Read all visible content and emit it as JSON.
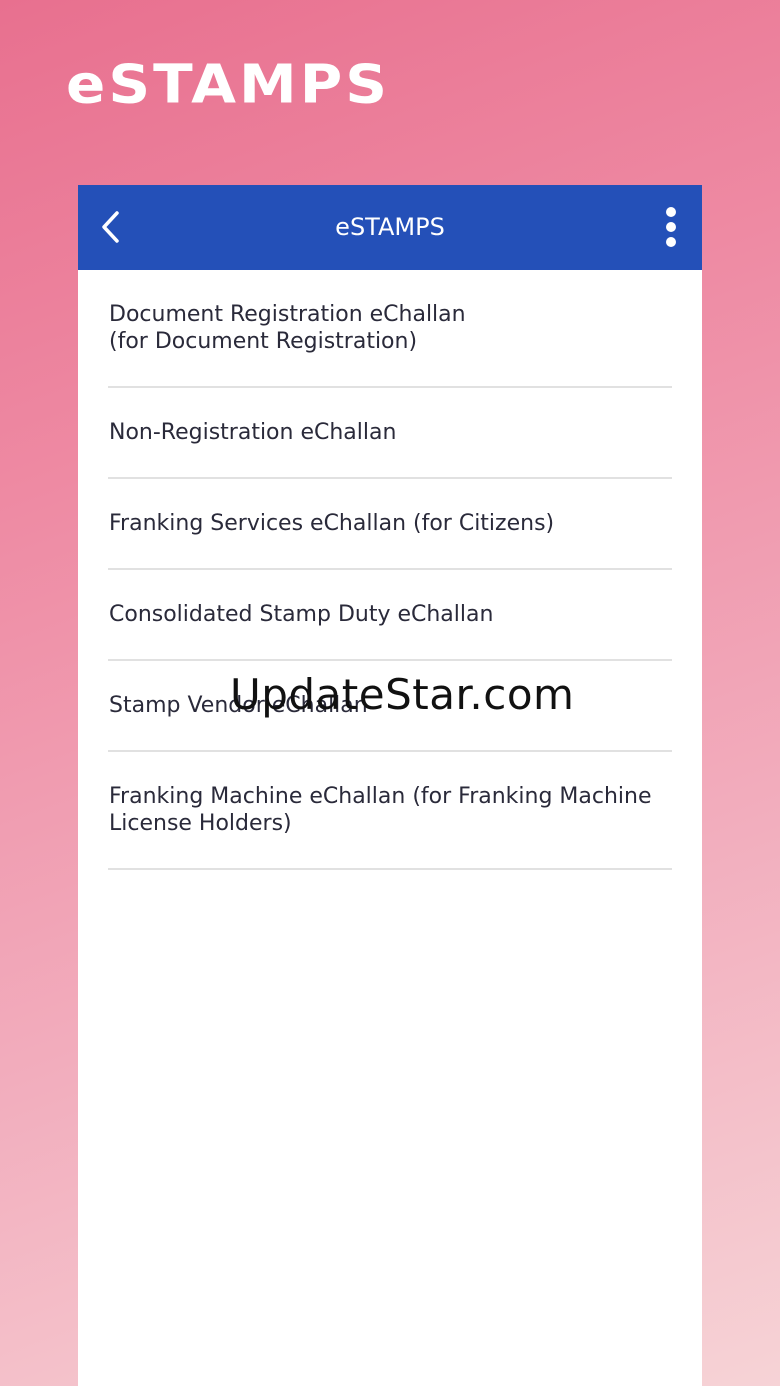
{
  "promo": {
    "title": "eSTAMPS"
  },
  "appbar": {
    "title": "eSTAMPS",
    "back_icon": "chevron-left-icon",
    "menu_icon": "more-vert-icon"
  },
  "menu_items": [
    {
      "label": "Document Registration eChallan\n(for Document Registration)"
    },
    {
      "label": "Non-Registration eChallan"
    },
    {
      "label": "Franking Services eChallan (for Citizens)"
    },
    {
      "label": "Consolidated Stamp Duty eChallan"
    },
    {
      "label": "Stamp Vendor eChallan"
    },
    {
      "label": "Franking Machine eChallan (for Franking Machine\nLicense Holders)"
    }
  ],
  "watermark": {
    "text": "UpdateStar.com"
  },
  "colors": {
    "appbar": "#2450b8",
    "background_top": "#e8708f",
    "background_bottom": "#f6d3d6"
  }
}
